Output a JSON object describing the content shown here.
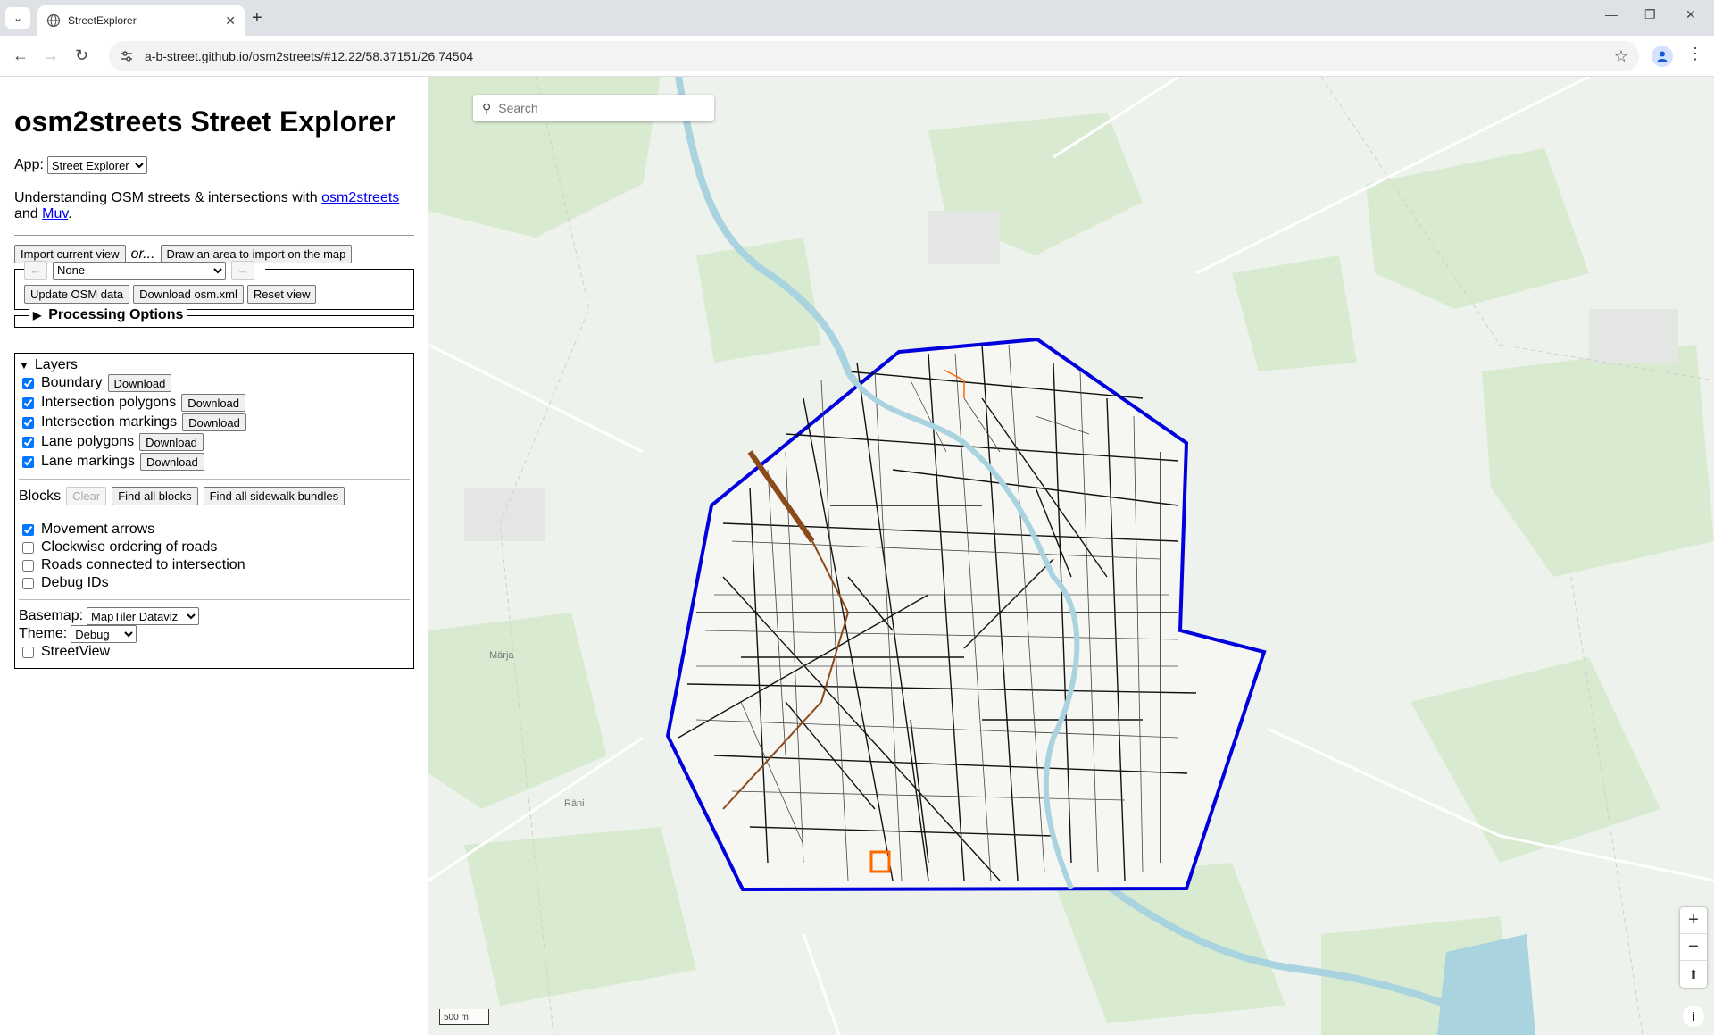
{
  "browser": {
    "tab_title": "StreetExplorer",
    "url": "a-b-street.github.io/osm2streets/#12.22/58.37151/26.74504"
  },
  "sidebar": {
    "title": "osm2streets Street Explorer",
    "app_label": "App:",
    "app_selected": "Street Explorer",
    "description_prefix": "Understanding OSM streets & intersections with",
    "link_osm2streets": "osm2streets",
    "description_and": "and",
    "link_muv": "Muv",
    "description_suffix": ".",
    "import_view_button": "Import current view",
    "or_text": "or...",
    "draw_area_button": "Draw an area to import on the map",
    "prev_arrow": "←",
    "next_arrow": "→",
    "test_selected": "None",
    "update_osm_button": "Update OSM data",
    "download_osm_button": "Download osm.xml",
    "reset_view_button": "Reset view",
    "processing_options": "Processing Options",
    "layers_title": "Layers",
    "layers": [
      {
        "label": "Boundary",
        "checked": true,
        "button": "Download"
      },
      {
        "label": "Intersection polygons",
        "checked": true,
        "button": "Download"
      },
      {
        "label": "Intersection markings",
        "checked": true,
        "button": "Download"
      },
      {
        "label": "Lane polygons",
        "checked": true,
        "button": "Download"
      },
      {
        "label": "Lane markings",
        "checked": true,
        "button": "Download"
      }
    ],
    "blocks_label": "Blocks",
    "clear_button": "Clear",
    "find_blocks_button": "Find all blocks",
    "find_sidewalk_button": "Find all sidewalk bundles",
    "options": [
      {
        "label": "Movement arrows",
        "checked": true
      },
      {
        "label": "Clockwise ordering of roads",
        "checked": false
      },
      {
        "label": "Roads connected to intersection",
        "checked": false
      },
      {
        "label": "Debug IDs",
        "checked": false
      }
    ],
    "basemap_label": "Basemap:",
    "basemap_selected": "MapTiler Dataviz",
    "theme_label": "Theme:",
    "theme_selected": "Debug",
    "streetview_label": "StreetView"
  },
  "map": {
    "search_placeholder": "Search",
    "scale_label": "500 m",
    "places": [
      "Märja",
      "Räni"
    ],
    "boundary_color": "#0000dd",
    "water_color": "#a9d3df",
    "park_color": "#d8ebd0"
  }
}
